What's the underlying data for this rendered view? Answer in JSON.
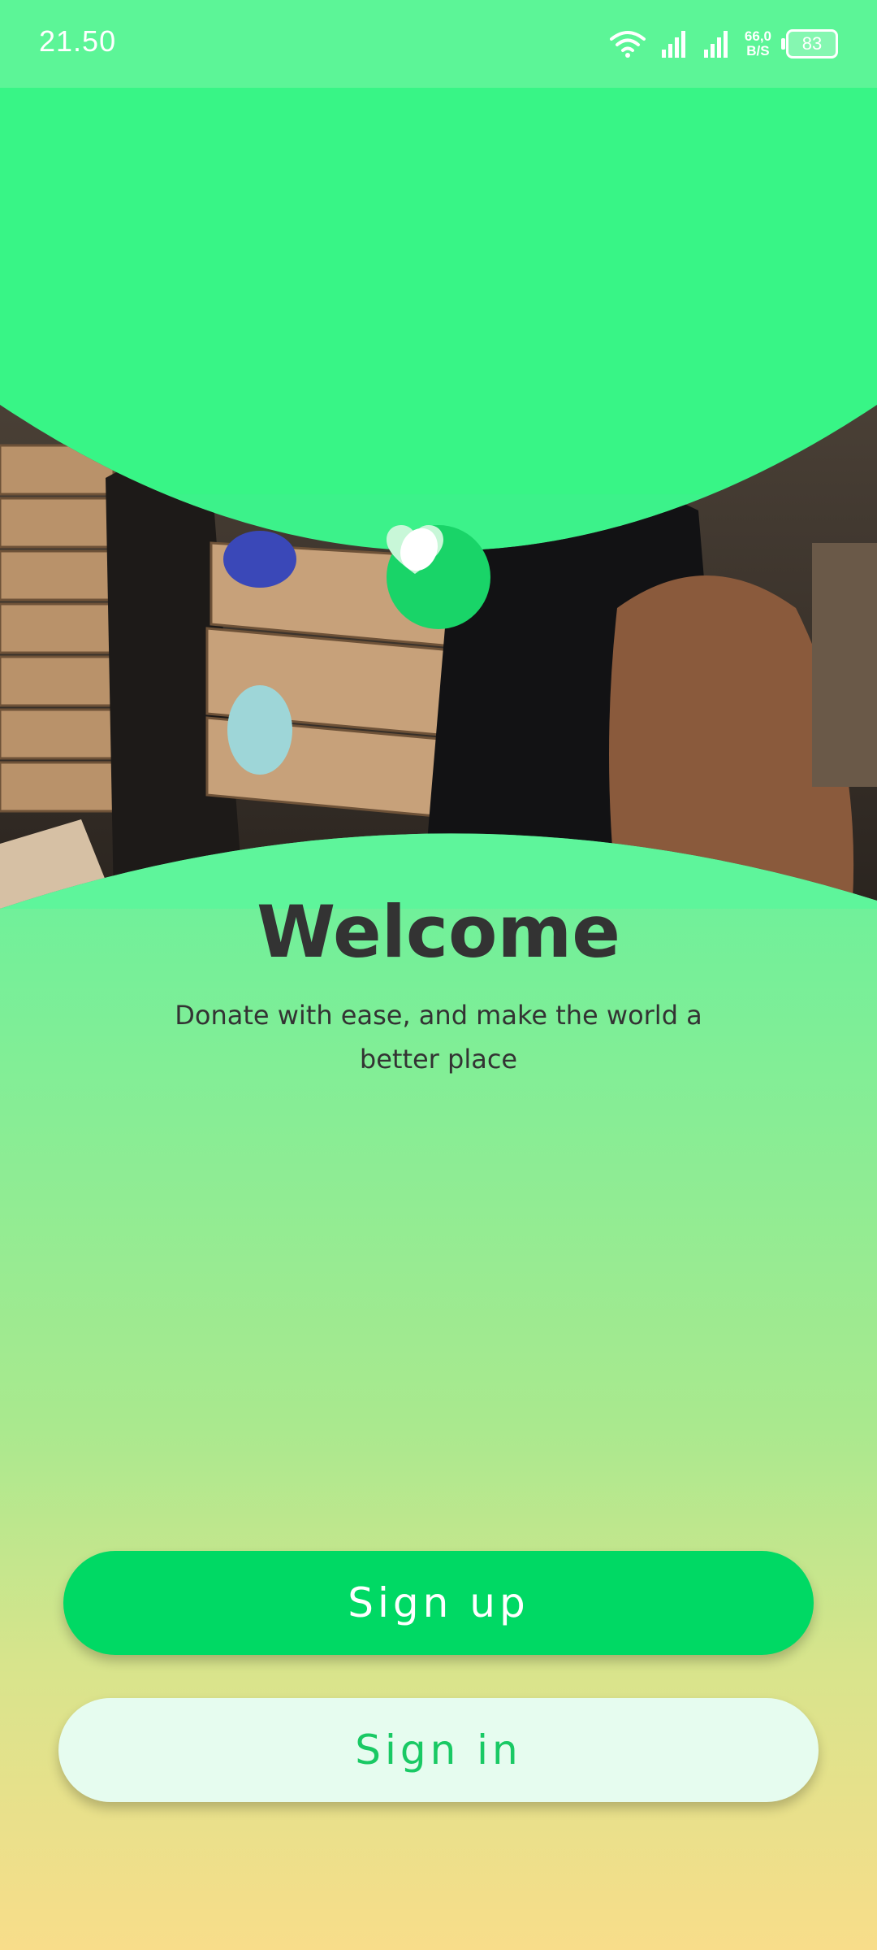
{
  "status_bar": {
    "time": "21.50",
    "net_speed_value": "66,0",
    "net_speed_unit": "B/S",
    "battery": "83",
    "icons": [
      "wifi-icon",
      "signal-icon",
      "signal-icon"
    ]
  },
  "hero": {
    "image_subject": "volunteers carrying boxes",
    "logo_icon": "heart-icon"
  },
  "welcome": {
    "title": "Welcome",
    "subtitle": "Donate with ease, and make the world a better place"
  },
  "actions": {
    "signup_label": "Sign up",
    "signin_label": "Sign in"
  },
  "colors": {
    "primary": "#00d964",
    "accent_light": "#e6fcef",
    "text_dark": "#333333"
  }
}
